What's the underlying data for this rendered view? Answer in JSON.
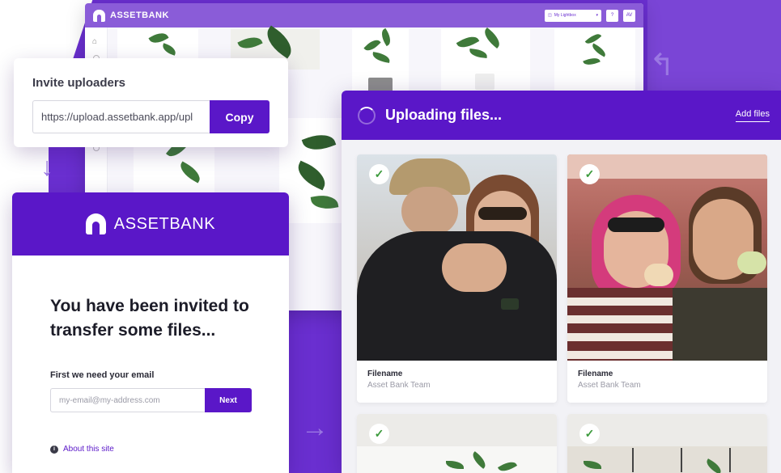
{
  "colors": {
    "brand": "#5a17c8",
    "background": "#6a2fd0",
    "success": "#3b9a3b"
  },
  "app": {
    "brand": "ASSETBANK",
    "lightbox": "My Lightbox",
    "help": "?",
    "avatar": "AV"
  },
  "invite_uploaders": {
    "title": "Invite uploaders",
    "url": "https://upload.assetbank.app/upl",
    "copy_label": "Copy"
  },
  "invite_email": {
    "brand": "ASSETBANK",
    "headline": "You have been invited to transfer some files...",
    "prompt": "First we need your email",
    "email_placeholder": "my-email@my-address.com",
    "next_label": "Next",
    "about_label": "About this site"
  },
  "upload": {
    "title": "Uploading files...",
    "add_files_label": "Add files",
    "files": [
      {
        "name": "Filename",
        "team": "Asset Bank Team",
        "status": "check-icon"
      },
      {
        "name": "Filename",
        "team": "Asset Bank Team",
        "status": "check-icon"
      },
      {
        "name": "",
        "team": "",
        "status": "check-icon"
      },
      {
        "name": "",
        "team": "",
        "status": "check-icon"
      }
    ]
  }
}
